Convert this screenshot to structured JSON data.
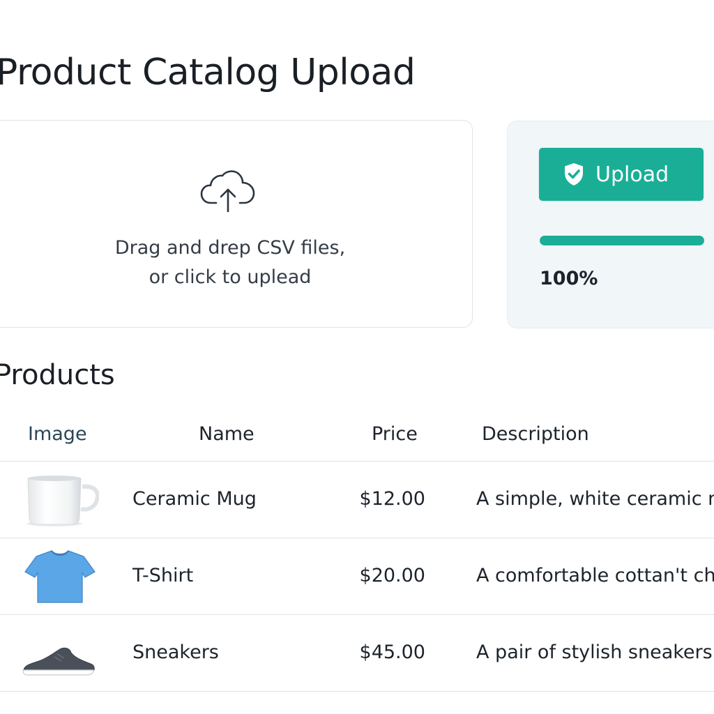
{
  "page": {
    "title": "Product Catalog Upload"
  },
  "dropzone": {
    "icon": "cloud-upload-icon",
    "line1": "Drag and drep CSV files,",
    "line2": "or click to uplead"
  },
  "upload": {
    "button_label": "Upload",
    "button_icon": "shield-check-icon",
    "progress_fraction": 1.0,
    "progress_text": "100%",
    "accent_color": "#1aae97"
  },
  "products": {
    "section_title": "Products",
    "columns": {
      "image": "Image",
      "name": "Name",
      "price": "Price",
      "description": "Description"
    },
    "rows": [
      {
        "image": "mug-image",
        "name": "Ceramic Mug",
        "price": "$12.00",
        "description": "A simple, white ceramic me"
      },
      {
        "image": "tshirt-image",
        "name": "T-Shirt",
        "price": "$20.00",
        "description": "A comfortable cottan't chic"
      },
      {
        "image": "sneaker-image",
        "name": "Sneakers",
        "price": "$45.00",
        "description": "A pair of stylish sneakers"
      }
    ]
  }
}
